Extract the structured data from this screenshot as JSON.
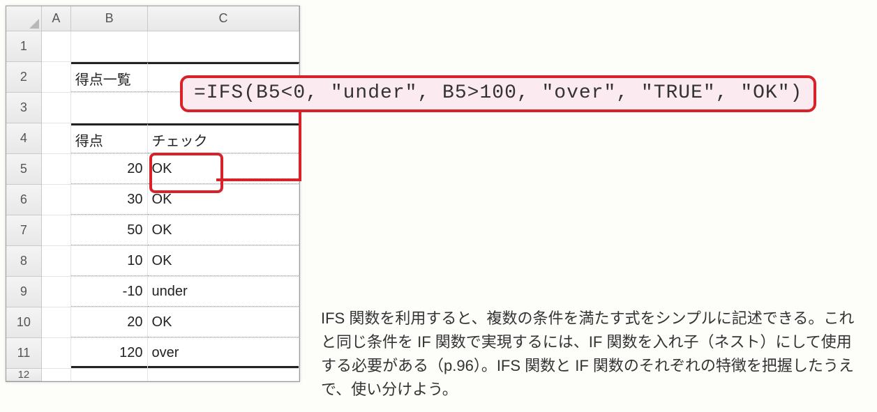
{
  "columns": {
    "A": "A",
    "B": "B",
    "C": "C"
  },
  "row_labels": [
    "1",
    "2",
    "3",
    "4",
    "5",
    "6",
    "7",
    "8",
    "9",
    "10",
    "11",
    "12"
  ],
  "sheet": {
    "title": "得点一覧",
    "header": {
      "score": "得点",
      "check": "チェック"
    },
    "rows": [
      {
        "score": "20",
        "check": "OK"
      },
      {
        "score": "30",
        "check": "OK"
      },
      {
        "score": "50",
        "check": "OK"
      },
      {
        "score": "10",
        "check": "OK"
      },
      {
        "score": "-10",
        "check": "under"
      },
      {
        "score": "20",
        "check": "OK"
      },
      {
        "score": "120",
        "check": "over"
      }
    ]
  },
  "formula": "=IFS(B5<0, \"under\", B5>100, \"over\", \"TRUE\", \"OK\")",
  "explanation": "IFS 関数を利用すると、複数の条件を満たす式をシンプルに記述できる。これと同じ条件を IF 関数で実現するには、IF 関数を入れ子（ネスト）にして使用する必要がある（p.96）。IFS 関数と IF 関数のそれぞれの特徴を把握したうえで、使い分けよう。"
}
